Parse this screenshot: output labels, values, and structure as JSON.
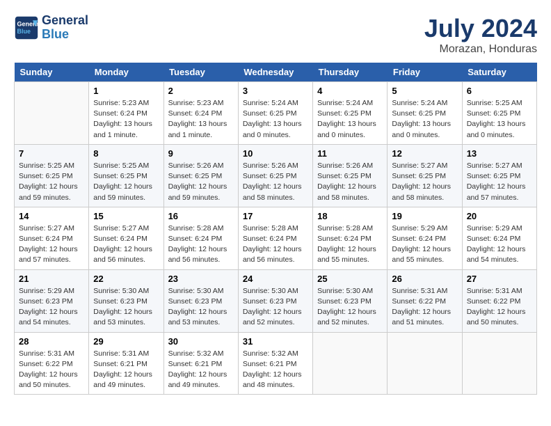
{
  "header": {
    "logo_line1": "General",
    "logo_line2": "Blue",
    "month_title": "July 2024",
    "location": "Morazan, Honduras"
  },
  "columns": [
    "Sunday",
    "Monday",
    "Tuesday",
    "Wednesday",
    "Thursday",
    "Friday",
    "Saturday"
  ],
  "weeks": [
    [
      {
        "day": "",
        "info": ""
      },
      {
        "day": "1",
        "info": "Sunrise: 5:23 AM\nSunset: 6:24 PM\nDaylight: 13 hours\nand 1 minute."
      },
      {
        "day": "2",
        "info": "Sunrise: 5:23 AM\nSunset: 6:24 PM\nDaylight: 13 hours\nand 1 minute."
      },
      {
        "day": "3",
        "info": "Sunrise: 5:24 AM\nSunset: 6:25 PM\nDaylight: 13 hours\nand 0 minutes."
      },
      {
        "day": "4",
        "info": "Sunrise: 5:24 AM\nSunset: 6:25 PM\nDaylight: 13 hours\nand 0 minutes."
      },
      {
        "day": "5",
        "info": "Sunrise: 5:24 AM\nSunset: 6:25 PM\nDaylight: 13 hours\nand 0 minutes."
      },
      {
        "day": "6",
        "info": "Sunrise: 5:25 AM\nSunset: 6:25 PM\nDaylight: 13 hours\nand 0 minutes."
      }
    ],
    [
      {
        "day": "7",
        "info": "Sunrise: 5:25 AM\nSunset: 6:25 PM\nDaylight: 12 hours\nand 59 minutes."
      },
      {
        "day": "8",
        "info": "Sunrise: 5:25 AM\nSunset: 6:25 PM\nDaylight: 12 hours\nand 59 minutes."
      },
      {
        "day": "9",
        "info": "Sunrise: 5:26 AM\nSunset: 6:25 PM\nDaylight: 12 hours\nand 59 minutes."
      },
      {
        "day": "10",
        "info": "Sunrise: 5:26 AM\nSunset: 6:25 PM\nDaylight: 12 hours\nand 58 minutes."
      },
      {
        "day": "11",
        "info": "Sunrise: 5:26 AM\nSunset: 6:25 PM\nDaylight: 12 hours\nand 58 minutes."
      },
      {
        "day": "12",
        "info": "Sunrise: 5:27 AM\nSunset: 6:25 PM\nDaylight: 12 hours\nand 58 minutes."
      },
      {
        "day": "13",
        "info": "Sunrise: 5:27 AM\nSunset: 6:25 PM\nDaylight: 12 hours\nand 57 minutes."
      }
    ],
    [
      {
        "day": "14",
        "info": "Sunrise: 5:27 AM\nSunset: 6:24 PM\nDaylight: 12 hours\nand 57 minutes."
      },
      {
        "day": "15",
        "info": "Sunrise: 5:27 AM\nSunset: 6:24 PM\nDaylight: 12 hours\nand 56 minutes."
      },
      {
        "day": "16",
        "info": "Sunrise: 5:28 AM\nSunset: 6:24 PM\nDaylight: 12 hours\nand 56 minutes."
      },
      {
        "day": "17",
        "info": "Sunrise: 5:28 AM\nSunset: 6:24 PM\nDaylight: 12 hours\nand 56 minutes."
      },
      {
        "day": "18",
        "info": "Sunrise: 5:28 AM\nSunset: 6:24 PM\nDaylight: 12 hours\nand 55 minutes."
      },
      {
        "day": "19",
        "info": "Sunrise: 5:29 AM\nSunset: 6:24 PM\nDaylight: 12 hours\nand 55 minutes."
      },
      {
        "day": "20",
        "info": "Sunrise: 5:29 AM\nSunset: 6:24 PM\nDaylight: 12 hours\nand 54 minutes."
      }
    ],
    [
      {
        "day": "21",
        "info": "Sunrise: 5:29 AM\nSunset: 6:23 PM\nDaylight: 12 hours\nand 54 minutes."
      },
      {
        "day": "22",
        "info": "Sunrise: 5:30 AM\nSunset: 6:23 PM\nDaylight: 12 hours\nand 53 minutes."
      },
      {
        "day": "23",
        "info": "Sunrise: 5:30 AM\nSunset: 6:23 PM\nDaylight: 12 hours\nand 53 minutes."
      },
      {
        "day": "24",
        "info": "Sunrise: 5:30 AM\nSunset: 6:23 PM\nDaylight: 12 hours\nand 52 minutes."
      },
      {
        "day": "25",
        "info": "Sunrise: 5:30 AM\nSunset: 6:23 PM\nDaylight: 12 hours\nand 52 minutes."
      },
      {
        "day": "26",
        "info": "Sunrise: 5:31 AM\nSunset: 6:22 PM\nDaylight: 12 hours\nand 51 minutes."
      },
      {
        "day": "27",
        "info": "Sunrise: 5:31 AM\nSunset: 6:22 PM\nDaylight: 12 hours\nand 50 minutes."
      }
    ],
    [
      {
        "day": "28",
        "info": "Sunrise: 5:31 AM\nSunset: 6:22 PM\nDaylight: 12 hours\nand 50 minutes."
      },
      {
        "day": "29",
        "info": "Sunrise: 5:31 AM\nSunset: 6:21 PM\nDaylight: 12 hours\nand 49 minutes."
      },
      {
        "day": "30",
        "info": "Sunrise: 5:32 AM\nSunset: 6:21 PM\nDaylight: 12 hours\nand 49 minutes."
      },
      {
        "day": "31",
        "info": "Sunrise: 5:32 AM\nSunset: 6:21 PM\nDaylight: 12 hours\nand 48 minutes."
      },
      {
        "day": "",
        "info": ""
      },
      {
        "day": "",
        "info": ""
      },
      {
        "day": "",
        "info": ""
      }
    ]
  ]
}
